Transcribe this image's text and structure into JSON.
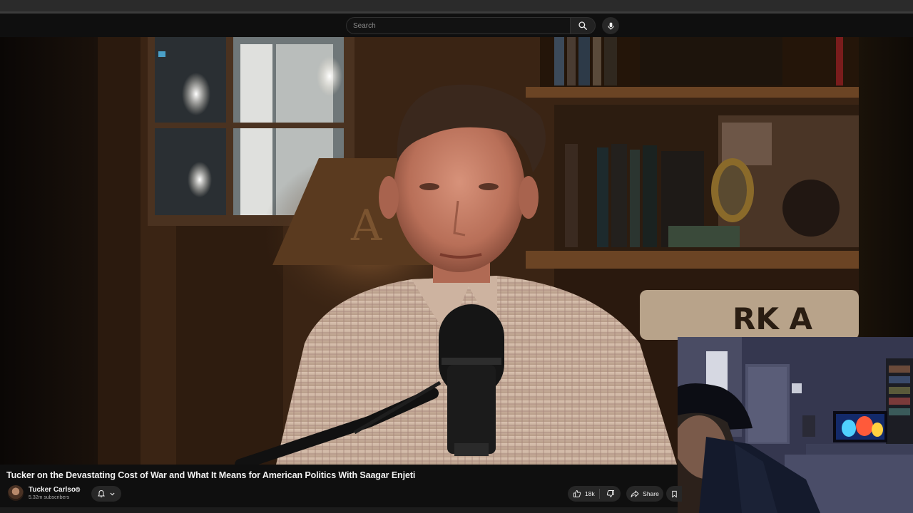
{
  "masthead": {
    "search_placeholder": "Search",
    "search_icon": "search-icon",
    "mic_icon": "mic-icon"
  },
  "video": {
    "title": "Tucker on the Devastating Cost of War and What It Means for American Politics With Saagar Enjeti",
    "channel": "Tucker Carlson",
    "subscribers": "5.32m subscribers",
    "likes": "18k",
    "share_label": "Share"
  },
  "colors": {
    "background": "#0f0f0f",
    "button_bg": "#272727",
    "text": "#f1f1f1",
    "muted": "#aaaaaa"
  }
}
